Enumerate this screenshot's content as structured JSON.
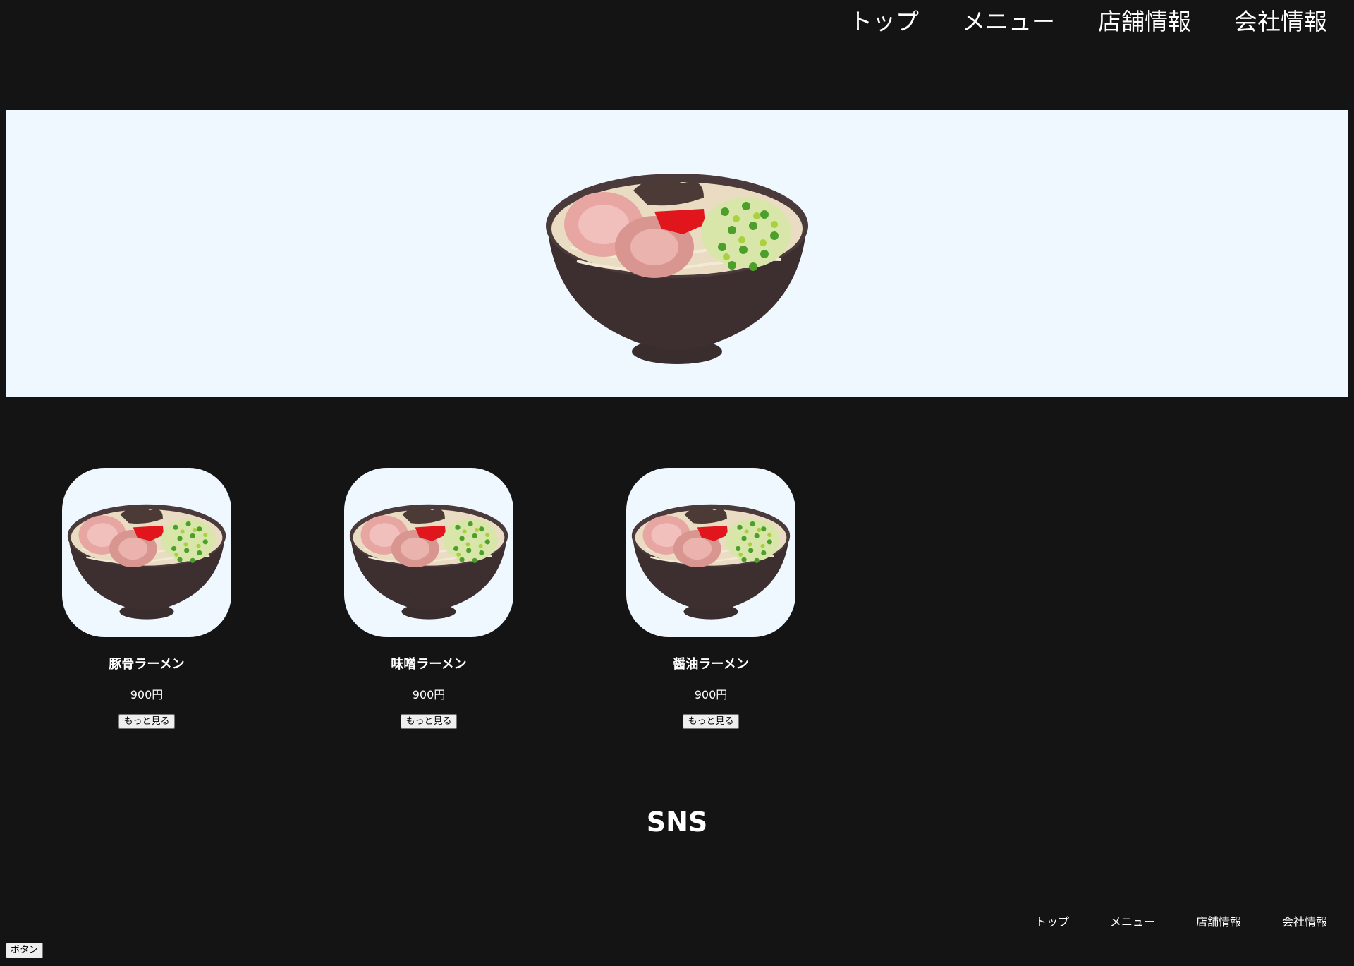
{
  "header": {
    "nav": [
      {
        "label": "トップ"
      },
      {
        "label": "メニュー"
      },
      {
        "label": "店舗情報"
      },
      {
        "label": "会社情報"
      }
    ]
  },
  "hero": {
    "image_icon": "ramen-bowl-icon",
    "background": "#f0f8ff"
  },
  "products": [
    {
      "name": "豚骨ラーメン",
      "price": "900円",
      "button_label": "もっと見る"
    },
    {
      "name": "味噌ラーメン",
      "price": "900円",
      "button_label": "もっと見る"
    },
    {
      "name": "醤油ラーメン",
      "price": "900円",
      "button_label": "もっと見る"
    }
  ],
  "sns": {
    "title": "SNS"
  },
  "footer": {
    "nav": [
      {
        "label": "トップ"
      },
      {
        "label": "メニュー"
      },
      {
        "label": "店舗情報"
      },
      {
        "label": "会社情報"
      }
    ],
    "button_label": "ボタン"
  },
  "colors": {
    "background": "#141414",
    "panel": "#f0f8ff",
    "text": "#ffffff"
  }
}
